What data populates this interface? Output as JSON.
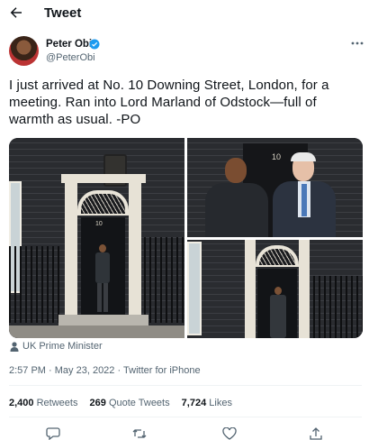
{
  "header": {
    "title": "Tweet"
  },
  "author": {
    "name": "Peter Obi",
    "handle": "@PeterObi"
  },
  "tweet": {
    "text_lines": [
      "I just arrived at No. 10 Downing Street, London, for a",
      "meeting. Ran into Lord Marland of Odstock—full of",
      "warmth as usual. -PO"
    ]
  },
  "media": {
    "door_number": "10"
  },
  "location": {
    "label": "UK Prime Minister"
  },
  "meta": {
    "time": "2:57 PM",
    "sep1": "·",
    "date": "May 23, 2022",
    "sep2": "·",
    "source": "Twitter for iPhone"
  },
  "stats": {
    "retweets": {
      "count": "2,400",
      "label": "Retweets"
    },
    "quotes": {
      "count": "269",
      "label": "Quote Tweets"
    },
    "likes": {
      "count": "7,724",
      "label": "Likes"
    }
  },
  "colors": {
    "verified": "#1d9bf0",
    "secondary_text": "#536471"
  }
}
